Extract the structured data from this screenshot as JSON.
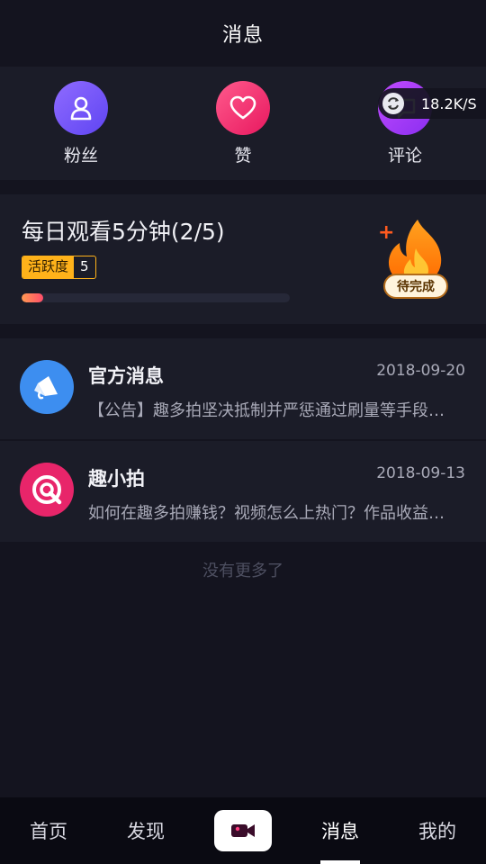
{
  "header": {
    "title": "消息"
  },
  "shortcuts": {
    "fans": {
      "label": "粉丝",
      "icon": "user-icon",
      "color": "#7b5cff"
    },
    "likes": {
      "label": "赞",
      "icon": "heart-icon",
      "color": "#f0336f"
    },
    "comments": {
      "label": "评论",
      "icon": "comment-icon",
      "color": "#b23ff8"
    }
  },
  "network_speed": {
    "text": "18.2K/S",
    "icon": "refresh-icon"
  },
  "daily_task": {
    "title": "每日观看5分钟(2/5)",
    "activity_label": "活跃度",
    "activity_value": "5",
    "progress": 0.08,
    "status_button": "待完成",
    "icon": "flame-icon"
  },
  "messages": [
    {
      "name": "官方消息",
      "date": "2018-09-20",
      "preview": "【公告】趣多拍坚决抵制并严惩通过刷量等手段作弊的行为",
      "icon": "megaphone-icon",
      "color": "#3d8ef0"
    },
    {
      "name": "趣小拍",
      "date": "2018-09-13",
      "preview": "如何在趣多拍赚钱？视频怎么上热门？作品收益怎么算？",
      "icon": "logo-icon",
      "color": "#e8256a"
    }
  ],
  "list_footer": "没有更多了",
  "bottom_nav": {
    "home": "首页",
    "discover": "发现",
    "record_icon": "video-camera-icon",
    "messages": "消息",
    "mine": "我的",
    "active": "消息"
  }
}
